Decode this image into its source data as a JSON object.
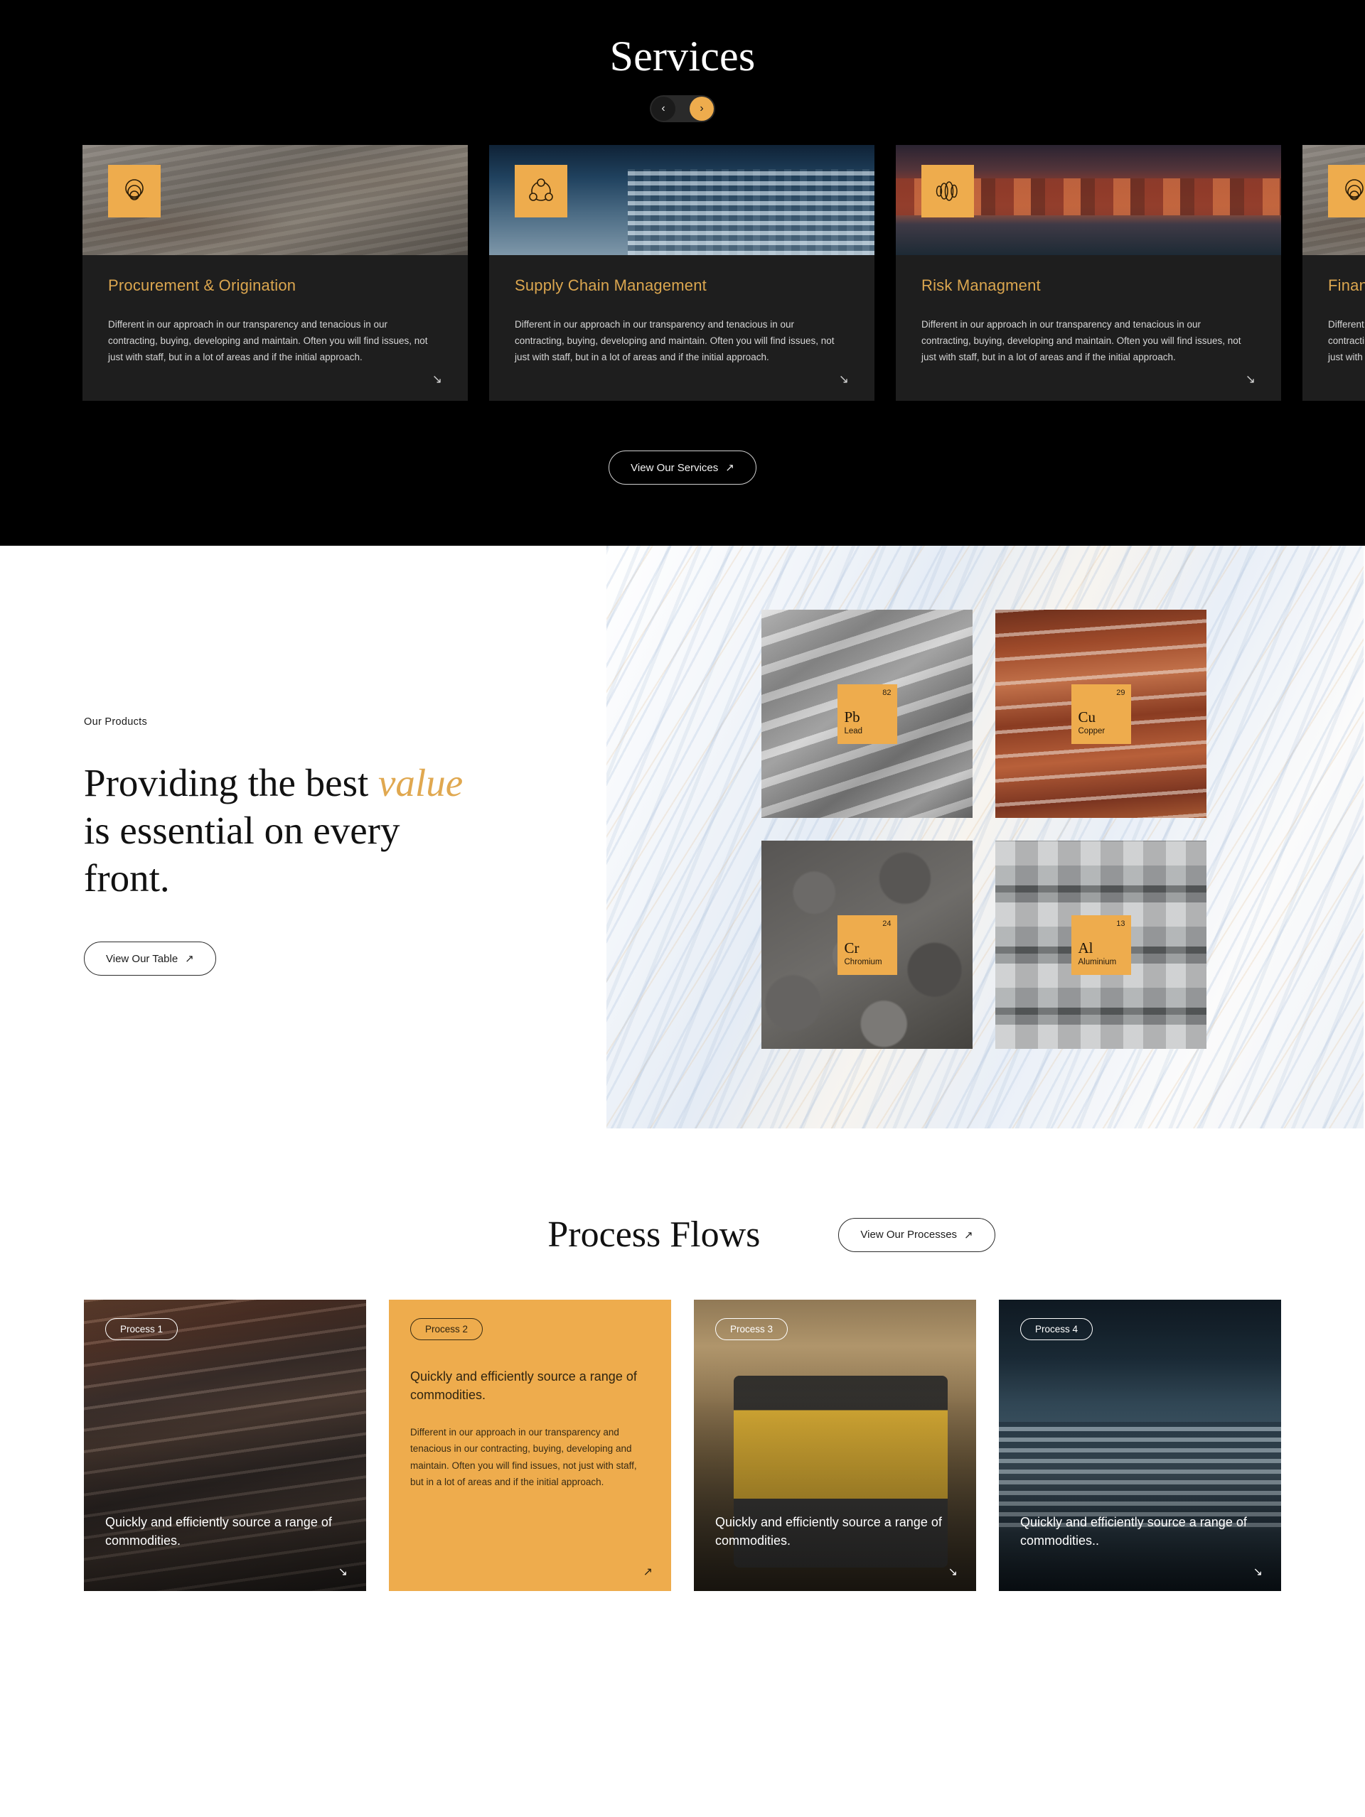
{
  "services": {
    "title": "Services",
    "nav": {
      "prev_label": "‹",
      "next_label": "›"
    },
    "cards": [
      {
        "title": "Procurement & Origination",
        "desc": "Different in our approach in our transparency and tenacious in our contracting, buying, developing and maintain.  Often you will find issues, not just with staff, but in a lot of areas and if the initial approach.",
        "icon": "concentric-circles-icon",
        "arrow": "↘"
      },
      {
        "title": "Supply Chain Management",
        "desc": "Different in our approach in our transparency and tenacious in our contracting, buying, developing and maintain.  Often you will find issues, not just with staff, but in a lot of areas and if the initial approach.",
        "icon": "network-nodes-icon",
        "arrow": "↘"
      },
      {
        "title": "Risk Managment",
        "desc": "Different in our approach in our transparency and tenacious in our contracting, buying, developing and maintain.  Often you will find issues, not just with staff, but in a lot of areas and if the initial approach.",
        "icon": "sound-wave-icon",
        "arrow": "↘"
      },
      {
        "title": "Finance",
        "desc": "Different in our approach in our transparency and tenacious in our contracting, buying, developing and maintain.  Often you will find issues, not just with staff, but in a lot of areas and if the initial approach.",
        "icon": "concentric-circles-icon",
        "arrow": "↘"
      }
    ],
    "cta": {
      "label": "View Our Services",
      "arrow": "↗"
    }
  },
  "products": {
    "eyebrow": "Our Products",
    "heading_part1": "Providing the best ",
    "heading_accent": "value",
    "heading_part2": " is essential on every front.",
    "cta": {
      "label": "View Our Table",
      "arrow": "↗"
    },
    "elements": [
      {
        "symbol": "Pb",
        "name": "Lead",
        "number": "82"
      },
      {
        "symbol": "Cu",
        "name": "Copper",
        "number": "29"
      },
      {
        "symbol": "Cr",
        "name": "Chromium",
        "number": "24"
      },
      {
        "symbol": "Al",
        "name": "Aluminium",
        "number": "13"
      }
    ]
  },
  "process": {
    "title": "Process Flows",
    "cta": {
      "label": "View Our Processes",
      "arrow": "↗"
    },
    "cards": [
      {
        "chip": "Process 1",
        "headline": "Quickly and efficiently source a range of commodities.",
        "body": "",
        "arrow": "↘"
      },
      {
        "chip": "Process 2",
        "headline": "Quickly and efficiently source a range of commodities.",
        "body": "Different in our approach in our transparency and tenacious in our contracting, buying, developing and maintain.  Often you will find issues, not just with staff, but in a lot of areas and if the initial approach.",
        "arrow": "↗"
      },
      {
        "chip": "Process 3",
        "headline": "Quickly and efficiently source a range of commodities.",
        "body": "",
        "arrow": "↘"
      },
      {
        "chip": "Process 4",
        "headline": "Quickly and efficiently source a range of commodities..",
        "body": "",
        "arrow": "↘"
      }
    ]
  },
  "colors": {
    "accent": "#eeac4d",
    "card_title": "#dba64f",
    "dark_bg": "#000000",
    "card_bg": "#1e1e1e"
  }
}
